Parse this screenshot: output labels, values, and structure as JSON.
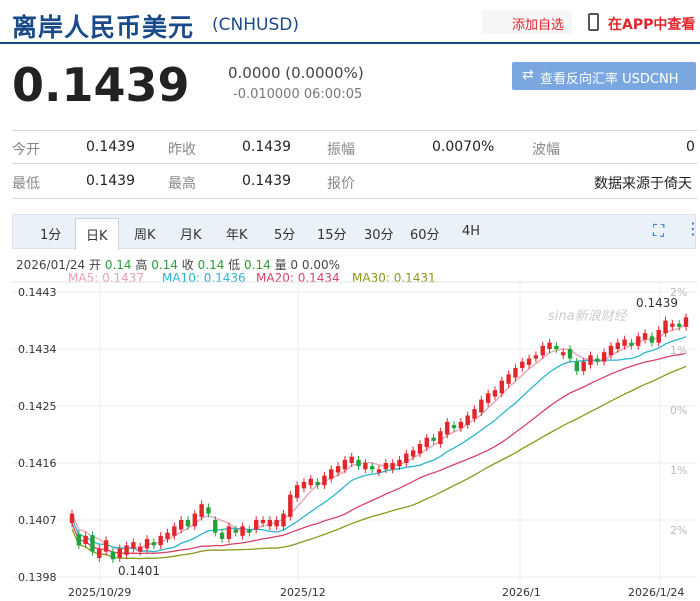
{
  "header": {
    "title": "离岸人民币美元",
    "code": "(CNHUSD)",
    "add_watchlist": "添加自选",
    "app_view": "在APP中查看"
  },
  "quote": {
    "price": "0.1439",
    "change": "0.0000 (0.0000%)",
    "sub_change": "-0.010000 06:00:05",
    "reverse_button": "查看反向汇率 USDCNH"
  },
  "stats": {
    "row1": [
      {
        "label": "今开",
        "value": "0.1439"
      },
      {
        "label": "昨收",
        "value": "0.1439"
      },
      {
        "label": "振幅",
        "value": "0.0070%"
      },
      {
        "label": "波幅",
        "value": "0"
      }
    ],
    "row2": [
      {
        "label": "最低",
        "value": "0.1439"
      },
      {
        "label": "最高",
        "value": "0.1439"
      },
      {
        "label": "报价",
        "value": "数据来源于倚天"
      }
    ]
  },
  "tabs": [
    "1分",
    "日K",
    "周K",
    "月K",
    "年K",
    "5分",
    "15分",
    "30分",
    "60分",
    "4H"
  ],
  "active_tab": "日K",
  "info_bar": {
    "date": "2026/01/24",
    "open_label": "开",
    "open": "0.14",
    "high_label": "高",
    "high": "0.14",
    "close_label": "收",
    "close": "0.14",
    "low_label": "低",
    "low": "0.14",
    "vol_label": "量",
    "vol": "0",
    "pct": "0.00%"
  },
  "ma_legend": [
    {
      "label": "MA5:",
      "value": "0.1437",
      "color": "#e8a0b8"
    },
    {
      "label": "MA10:",
      "value": "0.1436",
      "color": "#2bb5cf"
    },
    {
      "label": "MA20:",
      "value": "0.1434",
      "color": "#d8436c"
    },
    {
      "label": "MA30:",
      "value": "0.1431",
      "color": "#8a9a1a"
    }
  ],
  "chart_data": {
    "type": "candlestick",
    "y_ticks": [
      "0.1443",
      "0.1434",
      "0.1425",
      "0.1416",
      "0.1407",
      "0.1398"
    ],
    "y_ticks_right": [
      "2%",
      "1%",
      "0%",
      "1%",
      "2%"
    ],
    "x_ticks": [
      "2025/10/29",
      "2025/12",
      "2026/1",
      "2026/1/24"
    ],
    "ylim": [
      0.1398,
      0.1443
    ],
    "annotations": [
      {
        "text": "0.1439",
        "kind": "max"
      },
      {
        "text": "0.1401",
        "kind": "min"
      }
    ],
    "watermark": "sina新浪财经",
    "candles": [
      [
        0.14065,
        0.1408
      ],
      [
        0.14048,
        0.1403
      ],
      [
        0.14032,
        0.14045
      ],
      [
        0.14046,
        0.1402
      ],
      [
        0.1401,
        0.14025
      ],
      [
        0.1402,
        0.14038
      ],
      [
        0.1402,
        0.14008
      ],
      [
        0.1401,
        0.14025
      ],
      [
        0.14015,
        0.1403
      ],
      [
        0.14025,
        0.14035
      ],
      [
        0.1402,
        0.14028
      ],
      [
        0.14025,
        0.1404
      ],
      [
        0.14035,
        0.1403
      ],
      [
        0.1403,
        0.14045
      ],
      [
        0.1404,
        0.1405
      ],
      [
        0.14045,
        0.1406
      ],
      [
        0.14055,
        0.1407
      ],
      [
        0.1407,
        0.1406
      ],
      [
        0.1406,
        0.1408
      ],
      [
        0.14075,
        0.14095
      ],
      [
        0.1409,
        0.1408
      ],
      [
        0.1407,
        0.1405
      ],
      [
        0.1405,
        0.1404
      ],
      [
        0.1404,
        0.1406
      ],
      [
        0.14055,
        0.1405
      ],
      [
        0.14045,
        0.1406
      ],
      [
        0.14055,
        0.1405
      ],
      [
        0.14055,
        0.1407
      ],
      [
        0.14065,
        0.1407
      ],
      [
        0.1406,
        0.1407
      ],
      [
        0.1406,
        0.1407
      ],
      [
        0.1406,
        0.1408
      ],
      [
        0.14075,
        0.1411
      ],
      [
        0.14105,
        0.14125
      ],
      [
        0.1412,
        0.1413
      ],
      [
        0.14125,
        0.14135
      ],
      [
        0.1413,
        0.14125
      ],
      [
        0.14125,
        0.1414
      ],
      [
        0.14135,
        0.1415
      ],
      [
        0.14145,
        0.14155
      ],
      [
        0.1415,
        0.14165
      ],
      [
        0.1416,
        0.1417
      ],
      [
        0.14165,
        0.14155
      ],
      [
        0.1415,
        0.1416
      ],
      [
        0.14155,
        0.1415
      ],
      [
        0.14145,
        0.1415
      ],
      [
        0.1415,
        0.1416
      ],
      [
        0.1415,
        0.1416
      ],
      [
        0.14155,
        0.14165
      ],
      [
        0.1416,
        0.14175
      ],
      [
        0.1417,
        0.1418
      ],
      [
        0.14175,
        0.1419
      ],
      [
        0.14185,
        0.142
      ],
      [
        0.142,
        0.14195
      ],
      [
        0.1419,
        0.1421
      ],
      [
        0.14205,
        0.14225
      ],
      [
        0.1422,
        0.14215
      ],
      [
        0.14215,
        0.14225
      ],
      [
        0.1422,
        0.14235
      ],
      [
        0.1423,
        0.14245
      ],
      [
        0.1424,
        0.1426
      ],
      [
        0.14255,
        0.1427
      ],
      [
        0.14265,
        0.14275
      ],
      [
        0.1427,
        0.1429
      ],
      [
        0.14285,
        0.143
      ],
      [
        0.14295,
        0.1431
      ],
      [
        0.1431,
        0.1432
      ],
      [
        0.14315,
        0.14325
      ],
      [
        0.14325,
        0.1433
      ],
      [
        0.1433,
        0.14345
      ],
      [
        0.1434,
        0.1435
      ],
      [
        0.14345,
        0.1434
      ],
      [
        0.1433,
        0.14335
      ],
      [
        0.1434,
        0.14325
      ],
      [
        0.1432,
        0.14305
      ],
      [
        0.14305,
        0.1432
      ],
      [
        0.14315,
        0.1433
      ],
      [
        0.14325,
        0.1432
      ],
      [
        0.1432,
        0.14335
      ],
      [
        0.1433,
        0.14345
      ],
      [
        0.1434,
        0.1435
      ],
      [
        0.14345,
        0.14355
      ],
      [
        0.1435,
        0.14345
      ],
      [
        0.14345,
        0.1436
      ],
      [
        0.14355,
        0.14365
      ],
      [
        0.1436,
        0.1435
      ],
      [
        0.1435,
        0.1437
      ],
      [
        0.14365,
        0.14385
      ],
      [
        0.14375,
        0.1438
      ],
      [
        0.1438,
        0.14375
      ],
      [
        0.14375,
        0.1439
      ]
    ]
  }
}
